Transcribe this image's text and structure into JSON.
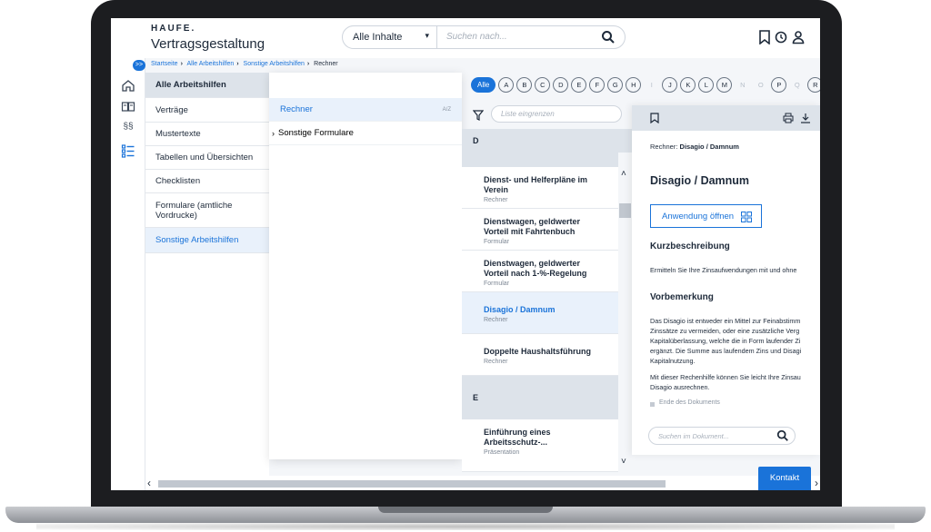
{
  "header": {
    "brand": "HAUFE.",
    "app_title": "Vertragsgestaltung",
    "search_scope": "Alle Inhalte",
    "search_placeholder": "Suchen nach...",
    "icons": [
      "bookmark-icon",
      "history-icon",
      "user-icon",
      "search-icon"
    ]
  },
  "breadcrumb": [
    "Startseite",
    "Alle Arbeitshilfen",
    "Sonstige Arbeitshilfen",
    "Rechner"
  ],
  "rail": {
    "toggle": ">>",
    "icons": [
      "home-icon",
      "book-icon",
      "paragraph-icon",
      "list-icon"
    ]
  },
  "categories": {
    "heading": "Alle Arbeitshilfen",
    "items": [
      "Verträge",
      "Mustertexte",
      "Tabellen und Übersichten",
      "Checklisten",
      "Formulare (amtliche Vordrucke)",
      "Sonstige Arbeitshilfen"
    ],
    "active": "Sonstige Arbeitshilfen"
  },
  "subcategories": {
    "items": [
      {
        "label": "Rechner",
        "badge": "A/Z",
        "selected": true
      },
      {
        "label": "Sonstige Formulare",
        "expandable": true
      }
    ]
  },
  "alphabet": {
    "all_label": "Alle",
    "letters": [
      {
        "ch": "A",
        "enabled": true
      },
      {
        "ch": "B",
        "enabled": true
      },
      {
        "ch": "C",
        "enabled": true
      },
      {
        "ch": "D",
        "enabled": true
      },
      {
        "ch": "E",
        "enabled": true
      },
      {
        "ch": "F",
        "enabled": true
      },
      {
        "ch": "G",
        "enabled": true
      },
      {
        "ch": "H",
        "enabled": true
      },
      {
        "ch": "I",
        "enabled": false
      },
      {
        "ch": "J",
        "enabled": true
      },
      {
        "ch": "K",
        "enabled": true
      },
      {
        "ch": "L",
        "enabled": true
      },
      {
        "ch": "M",
        "enabled": true
      },
      {
        "ch": "N",
        "enabled": false
      },
      {
        "ch": "O",
        "enabled": false
      },
      {
        "ch": "P",
        "enabled": true
      },
      {
        "ch": "Q",
        "enabled": false
      },
      {
        "ch": "R",
        "enabled": true
      }
    ]
  },
  "results": {
    "filter_placeholder": "Liste eingrenzen",
    "group_d": "D",
    "group_e": "E",
    "items": [
      {
        "title_1": "Dienst- und Helferpläne im",
        "title_2": "Verein",
        "type": "Rechner"
      },
      {
        "title_1": "Dienstwagen, geldwerter",
        "title_2": "Vorteil mit Fahrtenbuch",
        "type": "Formular"
      },
      {
        "title_1": "Dienstwagen, geldwerter",
        "title_2": "Vorteil nach 1-%-Regelung",
        "type": "Formular"
      },
      {
        "title_1": "Disagio / Damnum",
        "title_2": "",
        "type": "Rechner",
        "selected": true
      },
      {
        "title_1": "Doppelte Haushaltsführung",
        "title_2": "",
        "type": "Rechner"
      },
      {
        "title_1": "Einführung eines",
        "title_2": "Arbeitsschutz-...",
        "type": "Präsentation"
      }
    ]
  },
  "document": {
    "crumb_prefix": "Rechner: ",
    "crumb_title": "Disagio / Damnum",
    "title": "Disagio / Damnum",
    "open_button": "Anwendung öffnen",
    "section_1": "Kurzbeschreibung",
    "section_1_text": "Ermitteln Sie Ihre Zinsaufwendungen mit und ohne",
    "section_2": "Vorbemerkung",
    "section_2_lines": [
      "Das Disagio ist entweder ein Mittel zur Feinabstimm",
      "Zinssätze zu vermeiden, oder eine zusätzliche Verg",
      "Kapitalüberlassung, welche die in Form laufender Zi",
      "ergänzt. Die Summe aus laufendem Zins und Disagi",
      "Kapitalnutzung."
    ],
    "section_2b_lines": [
      "Mit dieser Rechenhilfe können Sie leicht Ihre Zinsau",
      "Disagio ausrechnen."
    ],
    "end_label": "Ende des Dokuments",
    "search_placeholder": "Suchen im Dokument..."
  },
  "footer": {
    "contact_button": "Kontakt"
  },
  "colors": {
    "accent": "#1a73d9",
    "text": "#1e2a3a",
    "panel_header": "#dde3ea",
    "selected_bg": "#e9f1fb"
  }
}
